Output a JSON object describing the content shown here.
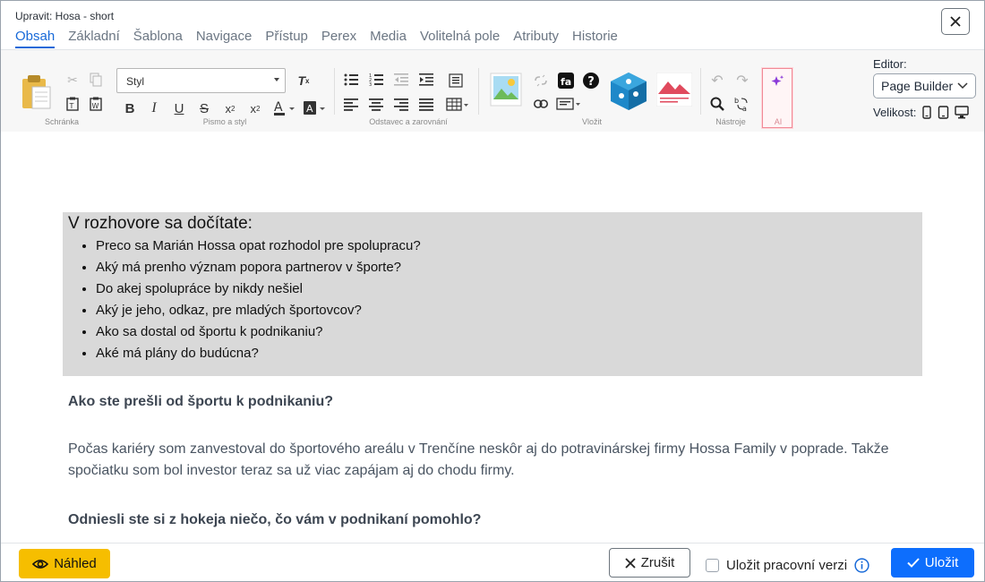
{
  "window": {
    "title": "Upravit: Hosa - short"
  },
  "tabs": [
    {
      "label": "Obsah",
      "active": true
    },
    {
      "label": "Základní"
    },
    {
      "label": "Šablona"
    },
    {
      "label": "Navigace"
    },
    {
      "label": "Přístup"
    },
    {
      "label": "Perex"
    },
    {
      "label": "Media"
    },
    {
      "label": "Volitelná pole"
    },
    {
      "label": "Atributy"
    },
    {
      "label": "Historie"
    }
  ],
  "toolbar": {
    "groups": {
      "clipboard": "Schránka",
      "font": "Pismo a styl",
      "paragraph": "Odstavec a zarovnání",
      "insert": "Vložit",
      "tools": "Nástroje",
      "ai": "AI"
    },
    "style_select": "Styl",
    "editor_label": "Editor:",
    "editor_value": "Page Builder",
    "size_label": "Velikost:"
  },
  "content": {
    "box_heading": "V rozhovore sa dočítate:",
    "bullets": [
      "Preco sa Marián Hossa opat rozhodol pre spolupracu?",
      "Aký má prenho význam popora partnerov v športe?",
      "Do akej spolupráce by nikdy nešiel",
      "Aký je jeho, odkaz, pre mladých športovcov?",
      "Ako sa dostal od športu k podnikaniu?",
      "Aké má plány do budúcna?"
    ],
    "q1": "Ako ste prešli od športu k podnikaniu?",
    "p1": "Počas kariéry som zanvestoval do športového areálu v Trenčíne neskôr aj do potravinárskej firmy Hossa Family v poprade. Takže spočiatku som bol investor teraz sa už viac zapájam aj do chodu firmy.",
    "q2": "Odniesli ste si z hokeja niečo, čo vám v podnikaní pomohlo?"
  },
  "footer": {
    "preview": "Náhled",
    "cancel": "Zrušit",
    "save_draft": "Uložit pracovní verzi",
    "save": "Uložit"
  },
  "colors": {
    "accent": "#1769d8",
    "save": "#0d6efd",
    "preview": "#f6be00",
    "ai_highlight": "#f08a96"
  }
}
